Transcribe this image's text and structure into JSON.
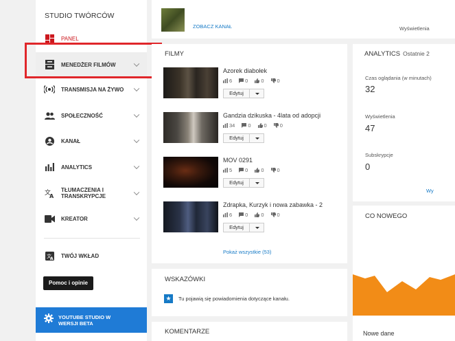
{
  "sidebar": {
    "title": "STUDIO TWÓRCÓW",
    "items": [
      {
        "label": "PANEL",
        "icon": "dashboard-icon"
      },
      {
        "label": "MENEDŻER FILMÓW",
        "icon": "video-manager-icon"
      },
      {
        "label": "TRANSMISJA NA ŻYWO",
        "icon": "live-icon"
      },
      {
        "label": "SPOŁECZNOŚĆ",
        "icon": "people-icon"
      },
      {
        "label": "KANAŁ",
        "icon": "account-icon"
      },
      {
        "label": "ANALYTICS",
        "icon": "bar-chart-icon"
      },
      {
        "label": "TŁUMACZENIA I TRANSKRYPCJE",
        "icon": "translate-icon"
      },
      {
        "label": "KREATOR",
        "icon": "video-camera-icon"
      }
    ],
    "contribute": "TWÓJ WKŁAD",
    "help_button": "Pomoc i opinie",
    "beta_label": "YOUTUBE STUDIO W WERSJI BETA",
    "accent": "#cc181e",
    "beta_color": "#1f7bd6"
  },
  "topbar": {
    "see_channel": "ZOBACZ KANAŁ",
    "views_label": "Wyświetlenia"
  },
  "films": {
    "title": "FILMY",
    "items": [
      {
        "title": "Azorek diabołek",
        "views": "6",
        "comments": "0",
        "likes": "0",
        "dislikes": "0"
      },
      {
        "title": "Gandzia dzikuska - 4lata od adopcji",
        "views": "34",
        "comments": "0",
        "likes": "0",
        "dislikes": "0"
      },
      {
        "title": "MOV 0291",
        "views": "5",
        "comments": "0",
        "likes": "0",
        "dislikes": "0"
      },
      {
        "title": "Zdrapka, Kurzyk i nowa zabawka - 2",
        "views": "6",
        "comments": "0",
        "likes": "0",
        "dislikes": "0"
      }
    ],
    "edit_label": "Edytuj",
    "show_all": "Pokaż wszystkie (53)"
  },
  "tips": {
    "title": "WSKAZÓWKI",
    "message": "Tu pojawią się powiadomienia dotyczące kanału."
  },
  "comments": {
    "title": "KOMENTARZE"
  },
  "analytics": {
    "title": "ANALYTICS",
    "period": "Ostatnie 2",
    "watch_time_label": "Czas oglądania (w minutach)",
    "watch_time_value": "32",
    "views_label": "Wyświetlenia",
    "views_value": "47",
    "subs_label": "Subskrypcje",
    "subs_value": "0",
    "more_link": "Wy"
  },
  "news": {
    "title": "CO NOWEGO",
    "footer": "Nowe dane",
    "chart_color": "#f28c17"
  }
}
